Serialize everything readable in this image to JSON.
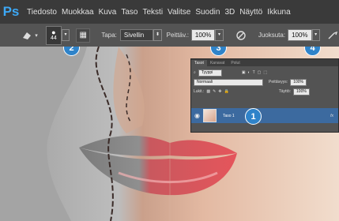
{
  "app": {
    "logo": "Ps"
  },
  "menu": [
    "Tiedosto",
    "Muokkaa",
    "Kuva",
    "Taso",
    "Teksti",
    "Valitse",
    "Suodin",
    "3D",
    "Näyttö",
    "Ikkuna"
  ],
  "options": {
    "brush_size": "44",
    "mode_label": "Tapa:",
    "mode_value": "Sivellin",
    "opacity_label": "Peittäv.:",
    "opacity_value": "100%",
    "flow_label": "Juoksuta:",
    "flow_value": "100%"
  },
  "layers_panel": {
    "tabs": [
      "Tasot",
      "Kanavat",
      "Polut"
    ],
    "filter_value": "Tyyppi",
    "blend_mode": "Normaali",
    "opacity_label": "Peittävyys:",
    "opacity_value": "100%",
    "lock_label": "Lukit.:",
    "fill_label": "Täyttö:",
    "fill_value": "100%",
    "layer_name": "Taso 1",
    "fx": "fx"
  },
  "callouts": [
    "1",
    "2",
    "3",
    "4"
  ],
  "colors": {
    "accent": "#2f83c9",
    "lips": "#e5555b"
  }
}
